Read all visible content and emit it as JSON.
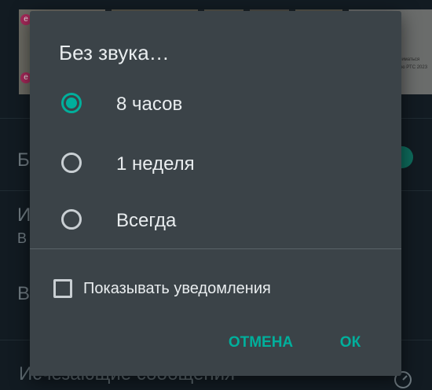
{
  "dialog": {
    "title": "Без звука…",
    "options": [
      {
        "label": "8 часов",
        "selected": true
      },
      {
        "label": "1 неделя",
        "selected": false
      },
      {
        "label": "Всегда",
        "selected": false
      }
    ],
    "show_notifications": {
      "label": "Показывать уведомления",
      "checked": false
    },
    "cancel_label": "ОТМЕНА",
    "ok_label": "ОК"
  },
  "background": {
    "letters": [
      "Б",
      "И",
      "В",
      "В"
    ],
    "bottom_row_text": "Исчезающие сообщения",
    "thumb_text_1": "ниматься",
    "thumb_text_2": "ью РТС 2023",
    "badge_letter": "е"
  },
  "colors": {
    "accent": "#00af9c",
    "dialog_bg": "#3b4348",
    "text_primary": "#e9edef",
    "control_outline": "#c9cfd3"
  },
  "icons": {
    "radio_selected": "radio-checked-icon",
    "radio_unselected": "radio-unchecked-icon",
    "checkbox": "checkbox-unchecked-icon",
    "timer": "timer-icon"
  }
}
